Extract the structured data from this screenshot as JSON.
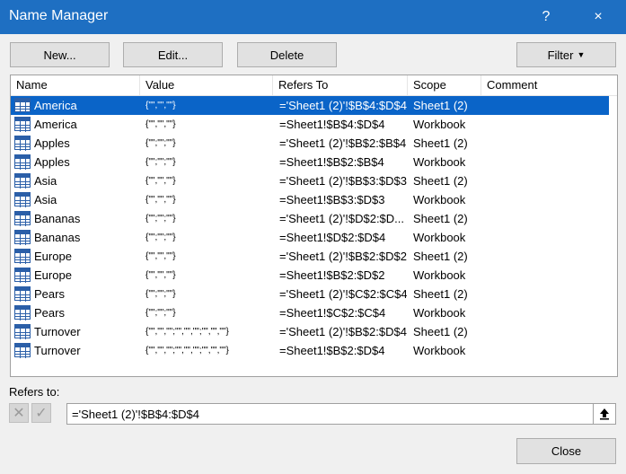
{
  "window": {
    "title": "Name Manager",
    "help": "?",
    "close": "×"
  },
  "toolbar": {
    "new": "New...",
    "edit": "Edit...",
    "delete": "Delete",
    "filter": "Filter"
  },
  "columns": [
    "Name",
    "Value",
    "Refers To",
    "Scope",
    "Comment"
  ],
  "rows": [
    {
      "name": "America",
      "value": "{\"\",\"\",\"\"}",
      "refers": "='Sheet1 (2)'!$B$4:$D$4",
      "scope": "Sheet1 (2)",
      "comment": "",
      "selected": true
    },
    {
      "name": "America",
      "value": "{\"\",\"\",\"\"}",
      "refers": "=Sheet1!$B$4:$D$4",
      "scope": "Workbook",
      "comment": ""
    },
    {
      "name": "Apples",
      "value": "{\"\";\"\";\"\"}",
      "refers": "='Sheet1 (2)'!$B$2:$B$4",
      "scope": "Sheet1 (2)",
      "comment": ""
    },
    {
      "name": "Apples",
      "value": "{\"\";\"\";\"\"}",
      "refers": "=Sheet1!$B$2:$B$4",
      "scope": "Workbook",
      "comment": ""
    },
    {
      "name": "Asia",
      "value": "{\"\",\"\",\"\"}",
      "refers": "='Sheet1 (2)'!$B$3:$D$3",
      "scope": "Sheet1 (2)",
      "comment": ""
    },
    {
      "name": "Asia",
      "value": "{\"\",\"\",\"\"}",
      "refers": "=Sheet1!$B$3:$D$3",
      "scope": "Workbook",
      "comment": ""
    },
    {
      "name": "Bananas",
      "value": "{\"\";\"\";\"\"}",
      "refers": "='Sheet1 (2)'!$D$2:$D...",
      "scope": "Sheet1 (2)",
      "comment": ""
    },
    {
      "name": "Bananas",
      "value": "{\"\";\"\";\"\"}",
      "refers": "=Sheet1!$D$2:$D$4",
      "scope": "Workbook",
      "comment": ""
    },
    {
      "name": "Europe",
      "value": "{\"\",\"\",\"\"}",
      "refers": "='Sheet1 (2)'!$B$2:$D$2",
      "scope": "Sheet1 (2)",
      "comment": ""
    },
    {
      "name": "Europe",
      "value": "{\"\",\"\",\"\"}",
      "refers": "=Sheet1!$B$2:$D$2",
      "scope": "Workbook",
      "comment": ""
    },
    {
      "name": "Pears",
      "value": "{\"\";\"\";\"\"}",
      "refers": "='Sheet1 (2)'!$C$2:$C$4",
      "scope": "Sheet1 (2)",
      "comment": ""
    },
    {
      "name": "Pears",
      "value": "{\"\";\"\";\"\"}",
      "refers": "=Sheet1!$C$2:$C$4",
      "scope": "Workbook",
      "comment": ""
    },
    {
      "name": "Turnover",
      "value": "{\"\",\"\",\"\";\"\",\"\",\"\";\"\",\"\",\"\"}",
      "refers": "='Sheet1 (2)'!$B$2:$D$4",
      "scope": "Sheet1 (2)",
      "comment": ""
    },
    {
      "name": "Turnover",
      "value": "{\"\",\"\",\"\";\"\",\"\",\"\";\"\",\"\",\"\"}",
      "refers": "=Sheet1!$B$2:$D$4",
      "scope": "Workbook",
      "comment": ""
    }
  ],
  "refers": {
    "label": "Refers to:",
    "value": "='Sheet1 (2)'!$B$4:$D$4"
  },
  "footer": {
    "close": "Close"
  },
  "colors": {
    "titlebar": "#1e6fc2",
    "selected": "#0a64c8"
  }
}
